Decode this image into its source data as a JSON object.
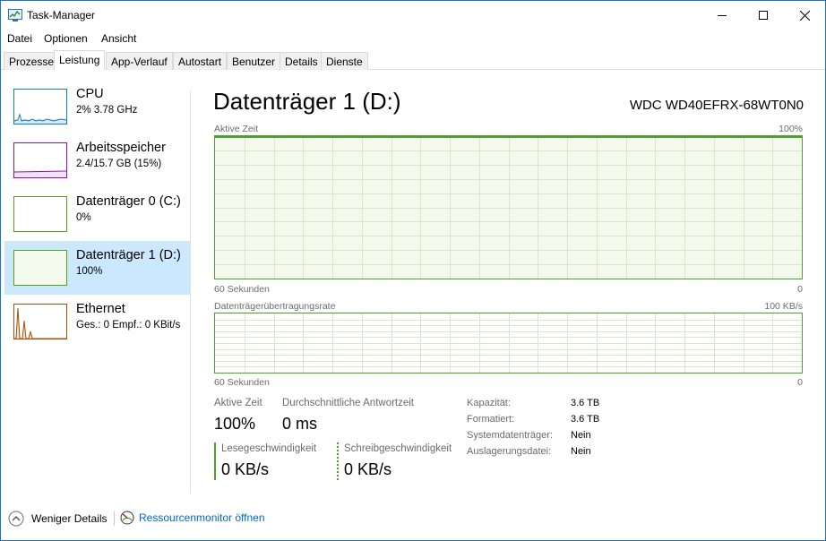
{
  "window": {
    "title": "Task-Manager"
  },
  "menu": [
    "Datei",
    "Optionen",
    "Ansicht"
  ],
  "tabs": [
    "Prozesse",
    "Leistung",
    "App-Verlauf",
    "Autostart",
    "Benutzer",
    "Details",
    "Dienste"
  ],
  "active_tab": "Leistung",
  "sidebar": {
    "items": [
      {
        "name": "CPU",
        "sub": "2%  3.78 GHz",
        "color": "#117dbb"
      },
      {
        "name": "Arbeitsspeicher",
        "sub": "2.4/15.7 GB (15%)",
        "color": "#8b12ae"
      },
      {
        "name": "Datenträger 0 (C:)",
        "sub": "0%",
        "color": "#4da60c"
      },
      {
        "name": "Datenträger 1 (D:)",
        "sub": "100%",
        "color": "#4da60c"
      },
      {
        "name": "Ethernet",
        "sub": "Ges.: 0  Empf.: 0 KBit/s",
        "color": "#a74f01"
      }
    ],
    "selected_index": 3
  },
  "main": {
    "title": "Datenträger 1 (D:)",
    "model": "WDC WD40EFRX-68WT0N0",
    "graph1": {
      "label": "Aktive Zeit",
      "max": "100%",
      "x_label": "60 Sekunden",
      "min": "0"
    },
    "graph2": {
      "label": "Datenträgerübertragungsrate",
      "max": "100 KB/s",
      "x_label": "60 Sekunden",
      "min": "0"
    },
    "stats": {
      "active_time_label": "Aktive Zeit",
      "active_time_value": "100%",
      "response_label": "Durchschnittliche Antwortzeit",
      "response_value": "0 ms",
      "read_label": "Lesegeschwindigkeit",
      "read_value": "0 KB/s",
      "write_label": "Schreibgeschwindigkeit",
      "write_value": "0 KB/s"
    },
    "properties": [
      {
        "key": "Kapazität:",
        "value": "3.6 TB"
      },
      {
        "key": "Formatiert:",
        "value": "3.6 TB"
      },
      {
        "key": "Systemdatenträger:",
        "value": "Nein"
      },
      {
        "key": "Auslagerungsdatei:",
        "value": "Nein"
      }
    ]
  },
  "footer": {
    "fewer_details": "Weniger Details",
    "resource_monitor": "Ressourcenmonitor öffnen"
  },
  "colors": {
    "disk_green": "#4ca22a",
    "accent_blue": "#cce8ff",
    "link": "#0066cc"
  }
}
